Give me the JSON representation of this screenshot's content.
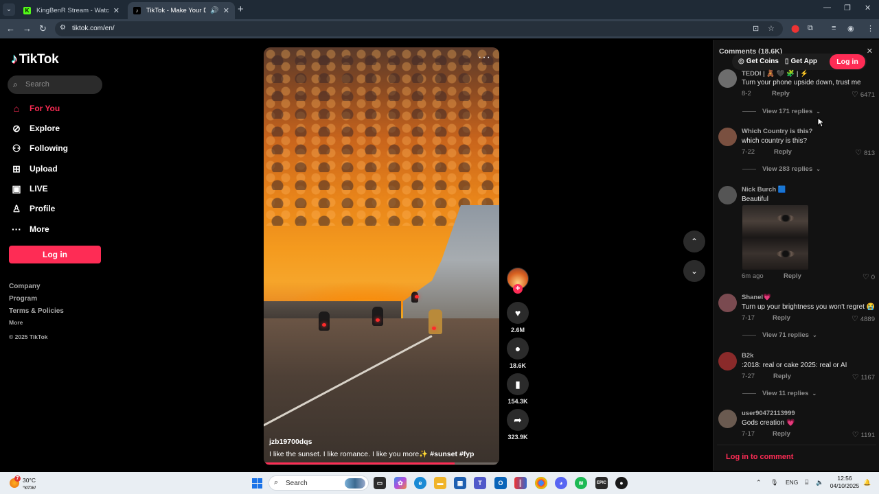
{
  "browser": {
    "tabs": [
      {
        "title": "KingBenR Stream - Watch Live",
        "favicon": "kick-icon",
        "active": false
      },
      {
        "title": "TikTok - Make Your Day",
        "favicon": "tiktok-icon",
        "active": true
      }
    ],
    "url": "tiktok.com/en/"
  },
  "sidebar": {
    "brand": "TikTok",
    "search_placeholder": "Search",
    "nav": [
      {
        "label": "For You",
        "icon": "home-icon",
        "active": true
      },
      {
        "label": "Explore",
        "icon": "compass-icon",
        "active": false
      },
      {
        "label": "Following",
        "icon": "following-icon",
        "active": false
      },
      {
        "label": "Upload",
        "icon": "upload-icon",
        "active": false
      },
      {
        "label": "LIVE",
        "icon": "live-icon",
        "active": false
      },
      {
        "label": "Profile",
        "icon": "profile-icon",
        "active": false
      },
      {
        "label": "More",
        "icon": "more-icon",
        "active": false
      }
    ],
    "login_label": "Log in",
    "footer": {
      "company": "Company",
      "program": "Program",
      "terms": "Terms & Policies",
      "more": "More",
      "copyright": "© 2025 TikTok"
    }
  },
  "video": {
    "username": "jzb19700dqs",
    "caption": "I like the sunset. I like romance. I like you more✨",
    "hashtags": [
      "#sunset",
      "#fyp"
    ],
    "progress": 0.81,
    "actions": {
      "likes": "2.6M",
      "comments": "18.6K",
      "saves": "154.3K",
      "shares": "323.9K"
    }
  },
  "comments_panel": {
    "header": "Comments (18.6K)",
    "get_coins": "Get Coins",
    "get_app": "Get App",
    "login": "Log in",
    "items": [
      {
        "name": "TEDDI | 🧸 🖤 🧩 | ⚡",
        "text": "Turn your phone upside down, trust me",
        "date": "8-2",
        "reply": "Reply",
        "likes": "6471",
        "view_replies": "View 171 replies",
        "avatar_color": "#6d6d6d"
      },
      {
        "name": "Which Country is this?",
        "text": "which country is this?",
        "date": "7-22",
        "reply": "Reply",
        "likes": "813",
        "view_replies": "View 283 replies",
        "avatar_color": "#7a5040"
      },
      {
        "name": "Nick Burch 🟦",
        "text": "Beautiful",
        "date": "6m ago",
        "reply": "Reply",
        "likes": "0",
        "view_replies": "",
        "avatar_color": "#555555"
      },
      {
        "name": "Shanel💗",
        "text": "Turn up your brightness you won't regret 😭",
        "date": "7-17",
        "reply": "Reply",
        "likes": "4889",
        "view_replies": "View 71 replies",
        "avatar_color": "#7a4a50"
      },
      {
        "name": "B2k",
        "text": ":2018: real or cake 2025: real or AI",
        "date": "7-27",
        "reply": "Reply",
        "likes": "1167",
        "view_replies": "View 11 replies",
        "avatar_color": "#8a2a2a"
      },
      {
        "name": "user90472113999",
        "text": "Gods creation 💗",
        "date": "7-17",
        "reply": "Reply",
        "likes": "1191",
        "view_replies": "",
        "avatar_color": "#6a5a50"
      }
    ],
    "login_to_comment": "Log in to comment"
  },
  "taskbar": {
    "weather_temp": "30°C",
    "weather_desc": "שמשי",
    "search_placeholder": "Search",
    "lang": "ENG",
    "time": "12:56",
    "date": "04/10/2025"
  }
}
